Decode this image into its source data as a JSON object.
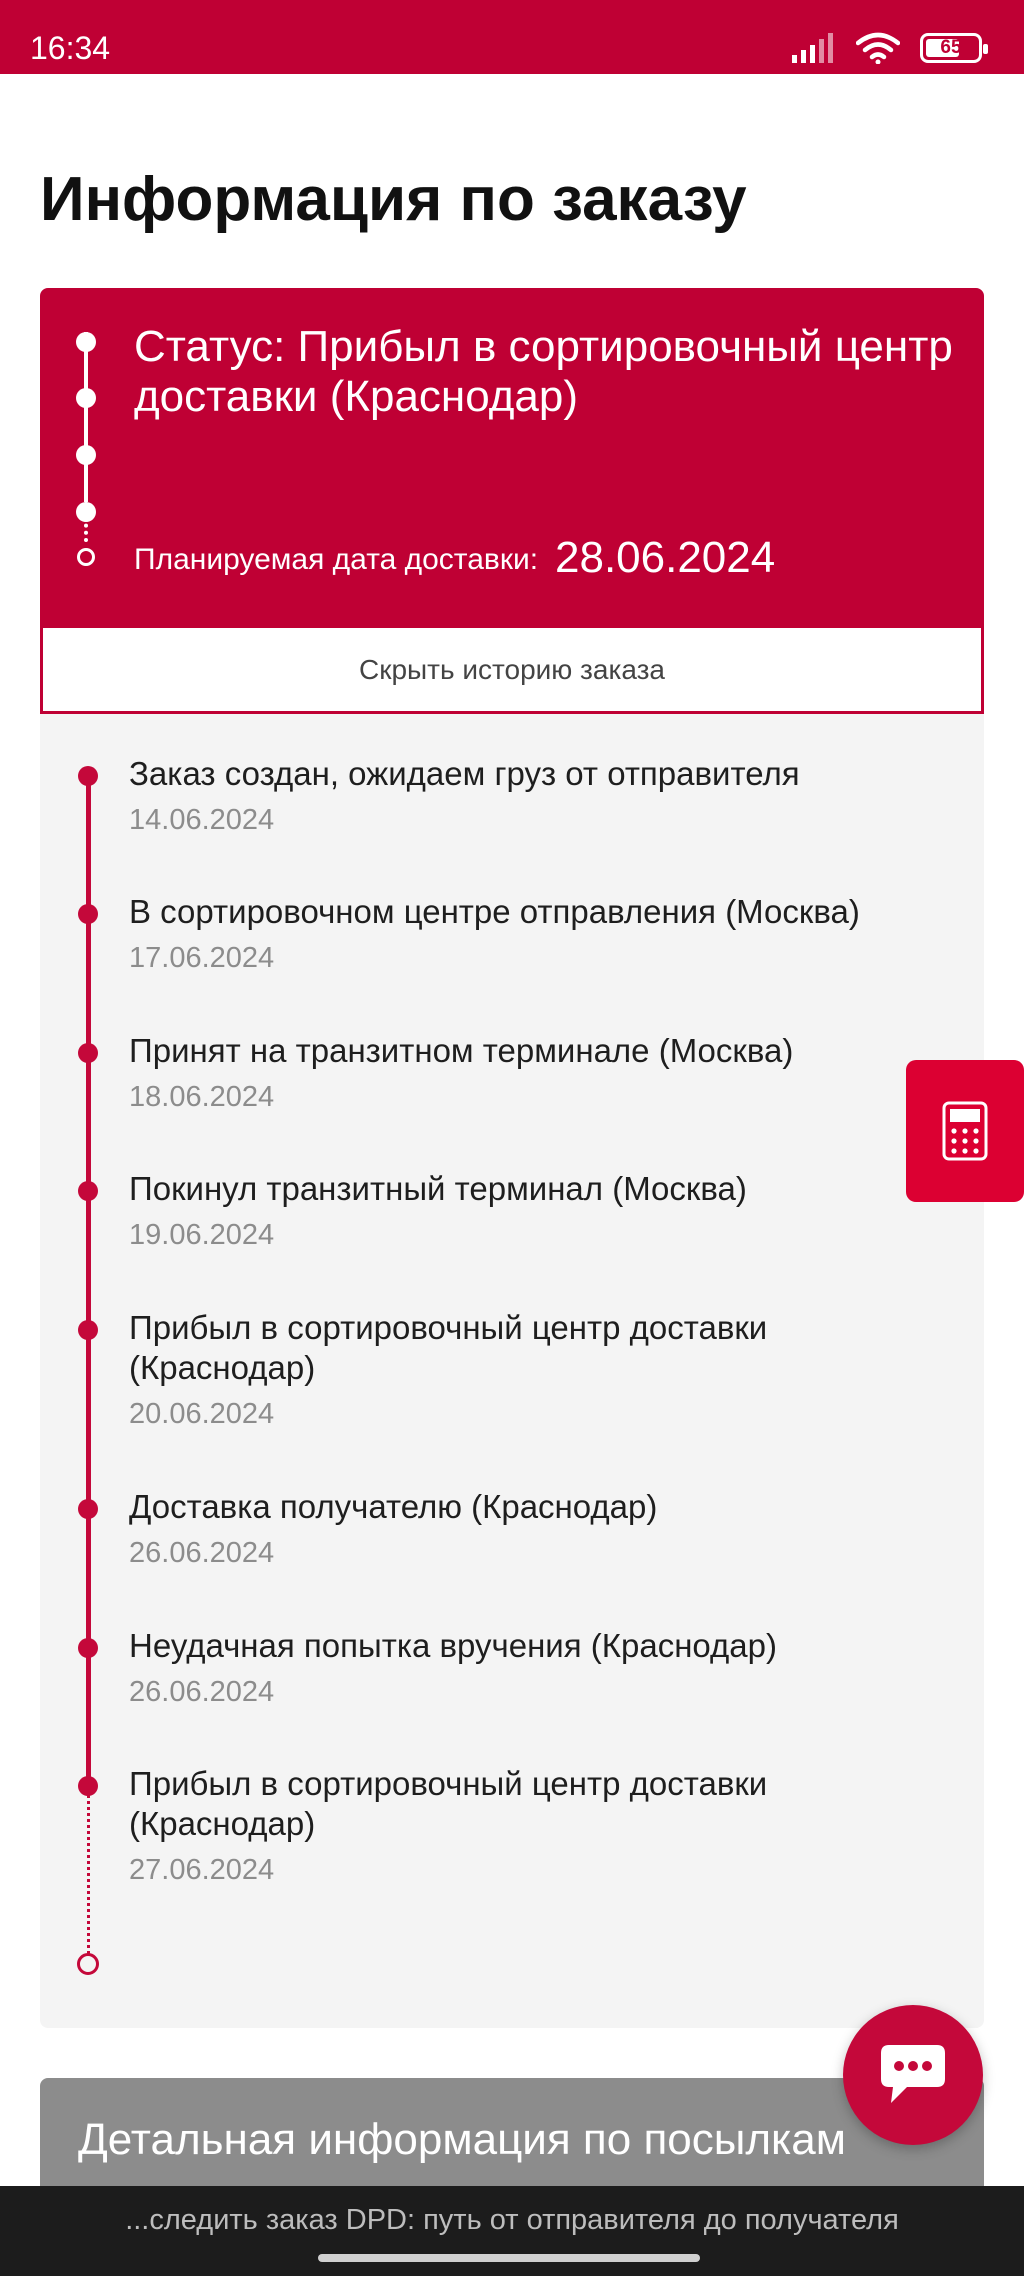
{
  "status_bar": {
    "time": "16:34",
    "battery_level": "65",
    "icons": [
      "signal-icon",
      "wifi-icon",
      "battery-icon"
    ]
  },
  "page": {
    "title": "Информация по заказу"
  },
  "status_card": {
    "status_text": "Статус: Прибыл в сортировочный центр доставки (Краснодар)",
    "delivery_date_label": "Планируемая дата доставки:",
    "delivery_date_value": "28.06.2024"
  },
  "history_toggle": {
    "label": "Скрыть историю заказа"
  },
  "history": [
    {
      "title": "Заказ создан, ожидаем груз от отправителя",
      "date": "14.06.2024"
    },
    {
      "title": "В сортировочном центре отправления (Москва)",
      "date": "17.06.2024"
    },
    {
      "title": "Принят на транзитном терминале (Москва)",
      "date": "18.06.2024"
    },
    {
      "title": "Покинул транзитный терминал (Москва)",
      "date": "19.06.2024"
    },
    {
      "title": "Прибыл в сортировочный центр доставки (Краснодар)",
      "date": "20.06.2024"
    },
    {
      "title": "Доставка получателю (Краснодар)",
      "date": "26.06.2024"
    },
    {
      "title": "Неудачная попытка вручения (Краснодар)",
      "date": "26.06.2024"
    },
    {
      "title": "Прибыл в сортировочный центр доставки (Краснодар)",
      "date": "27.06.2024"
    }
  ],
  "details": {
    "header": "Детальная информация по посылкам"
  },
  "bottom_bar": {
    "text": "...следить заказ DPD: путь от отправителя до получателя"
  },
  "colors": {
    "brand": "#bf0034",
    "timeline": "#c4083a",
    "calculator": "#dc0032",
    "panel_bg": "#f4f4f4",
    "details_bg": "#8c8c8c"
  }
}
